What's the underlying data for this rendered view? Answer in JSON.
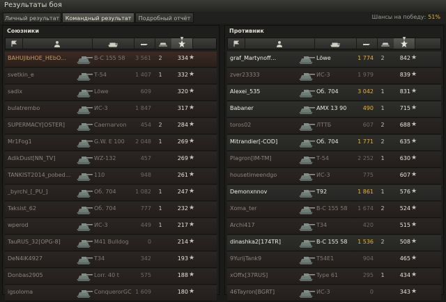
{
  "window": {
    "title": "Результаты боя"
  },
  "tabs": [
    {
      "label": "Личный результат",
      "active": false
    },
    {
      "label": "Командный результат",
      "active": true
    },
    {
      "label": "Подробный отчёт",
      "active": false
    }
  ],
  "chance": {
    "label": "Шансы на победу:",
    "value": "51%"
  },
  "allies": {
    "title": "Союзники",
    "rows": [
      {
        "nick": "BAHUJlbHOE_HEbO...",
        "tank": "В-С 155 58",
        "dmg": "3 561",
        "kills": "2",
        "xp": "334",
        "state": "me"
      },
      {
        "nick": "svetkin_e",
        "tank": "Т-54",
        "dmg": "1 407",
        "kills": "1",
        "xp": "332",
        "state": "dead"
      },
      {
        "nick": "sadix",
        "tank": "Löwe",
        "dmg": "609",
        "kills": "",
        "xp": "320",
        "state": "dead"
      },
      {
        "nick": "bulatrembo",
        "tank": "ИС-3",
        "dmg": "1 847",
        "kills": "",
        "xp": "317",
        "state": "dead"
      },
      {
        "nick": "SUPERMACY[OSTER]",
        "tank": "Caernarvon",
        "dmg": "454",
        "kills": "2",
        "xp": "284",
        "state": "dead"
      },
      {
        "nick": "Mr1Fog1",
        "tank": "G.W. E 100",
        "dmg": "2 048",
        "kills": "1",
        "xp": "269",
        "state": "dead"
      },
      {
        "nick": "AdikDust[NN_TV]",
        "tank": "WZ-132",
        "dmg": "457",
        "kills": "",
        "xp": "269",
        "state": "dead"
      },
      {
        "nick": "TANKIST2014_pobed...",
        "tank": "110",
        "dmg": "948",
        "kills": "",
        "xp": "261",
        "state": "dead"
      },
      {
        "nick": "_byrchi_[_PU_]",
        "tank": "Об. 704",
        "dmg": "1 082",
        "kills": "1",
        "xp": "247",
        "state": "dead"
      },
      {
        "nick": "Taksist_62",
        "tank": "Об. 704",
        "dmg": "777",
        "kills": "1",
        "xp": "232",
        "state": "dead"
      },
      {
        "nick": "wperod",
        "tank": "ИС-3",
        "dmg": "449",
        "kills": "1",
        "xp": "217",
        "state": "dead"
      },
      {
        "nick": "TauRUS_32[OPG-8]",
        "tank": "M41 Bulldog",
        "dmg": "0",
        "kills": "",
        "xp": "214",
        "state": "dead"
      },
      {
        "nick": "DeN4iK4927",
        "tank": "Т34",
        "dmg": "342",
        "kills": "",
        "xp": "193",
        "state": "dead"
      },
      {
        "nick": "Donbas2905",
        "tank": "Lorr. 40 t",
        "dmg": "575",
        "kills": "",
        "xp": "188",
        "state": "dead"
      },
      {
        "nick": "igsoloma",
        "tank": "ConquerorGC",
        "dmg": "1 609",
        "kills": "",
        "xp": "180",
        "state": "dead"
      }
    ]
  },
  "enemies": {
    "title": "Противник",
    "rows": [
      {
        "nick": "graf_Martynoff...",
        "tank": "Löwe",
        "dmg": "1 774",
        "kills": "2",
        "xp": "842",
        "state": "alive"
      },
      {
        "nick": "zver23333",
        "tank": "ИС-3",
        "dmg": "1 979",
        "kills": "",
        "xp": "839",
        "state": "dead"
      },
      {
        "nick": "Alexei_535",
        "tank": "Об. 704",
        "dmg": "3 042",
        "kills": "1",
        "xp": "831",
        "state": "alive"
      },
      {
        "nick": "Babaner",
        "tank": "AMX 13 90",
        "dmg": "490",
        "kills": "1",
        "xp": "715",
        "state": "alive"
      },
      {
        "nick": "toros02",
        "tank": "ЛТТБ",
        "dmg": "607",
        "kills": "2",
        "xp": "688",
        "state": "dead"
      },
      {
        "nick": "Mitrandier[-COD]",
        "tank": "Об. 704",
        "dmg": "1 771",
        "kills": "2",
        "xp": "635",
        "state": "alive"
      },
      {
        "nick": "Plagron[IM-TM]",
        "tank": "Т-54",
        "dmg": "2 252",
        "kills": "1",
        "xp": "630",
        "state": "dead"
      },
      {
        "nick": "housetimeendgo",
        "tank": "ИС-3",
        "dmg": "775",
        "kills": "",
        "xp": "607",
        "state": "dead"
      },
      {
        "nick": "Demonxnnov",
        "tank": "T92",
        "dmg": "1 861",
        "kills": "1",
        "xp": "576",
        "state": "alive"
      },
      {
        "nick": "Xoma_ter",
        "tank": "В-С 155 58",
        "dmg": "1 674",
        "kills": "2",
        "xp": "524",
        "state": "dead"
      },
      {
        "nick": "Archi417",
        "tank": "Т34",
        "dmg": "420",
        "kills": "",
        "xp": "515",
        "state": "dead"
      },
      {
        "nick": "dinashka2[174TR]",
        "tank": "В-С 155 58",
        "dmg": "1 536",
        "kills": "2",
        "xp": "508",
        "state": "alive"
      },
      {
        "nick": "9YurijTank9",
        "tank": "T54E1",
        "dmg": "904",
        "kills": "",
        "xp": "465",
        "state": "dead"
      },
      {
        "nick": "xOffx[37RUS]",
        "tank": "Type 61",
        "dmg": "295",
        "kills": "1",
        "xp": "434",
        "state": "dead"
      },
      {
        "nick": "46Tayron[BGRT]",
        "tank": "ИС-3",
        "dmg": "0",
        "kills": "",
        "xp": "343",
        "state": "dead"
      }
    ]
  },
  "icons": {
    "sort": "arrow-down-icon",
    "platoon": "flag-icon",
    "player": "person-icon",
    "tank": "tank-icon",
    "damage": "shell-icon",
    "frags": "tank-silhouette-icon",
    "xp": "star-icon"
  },
  "colors": {
    "accent": "#e6b33c",
    "alive_text": "#f0eee6",
    "dead_text": "#8a857c",
    "player_text": "#c89a6a"
  }
}
